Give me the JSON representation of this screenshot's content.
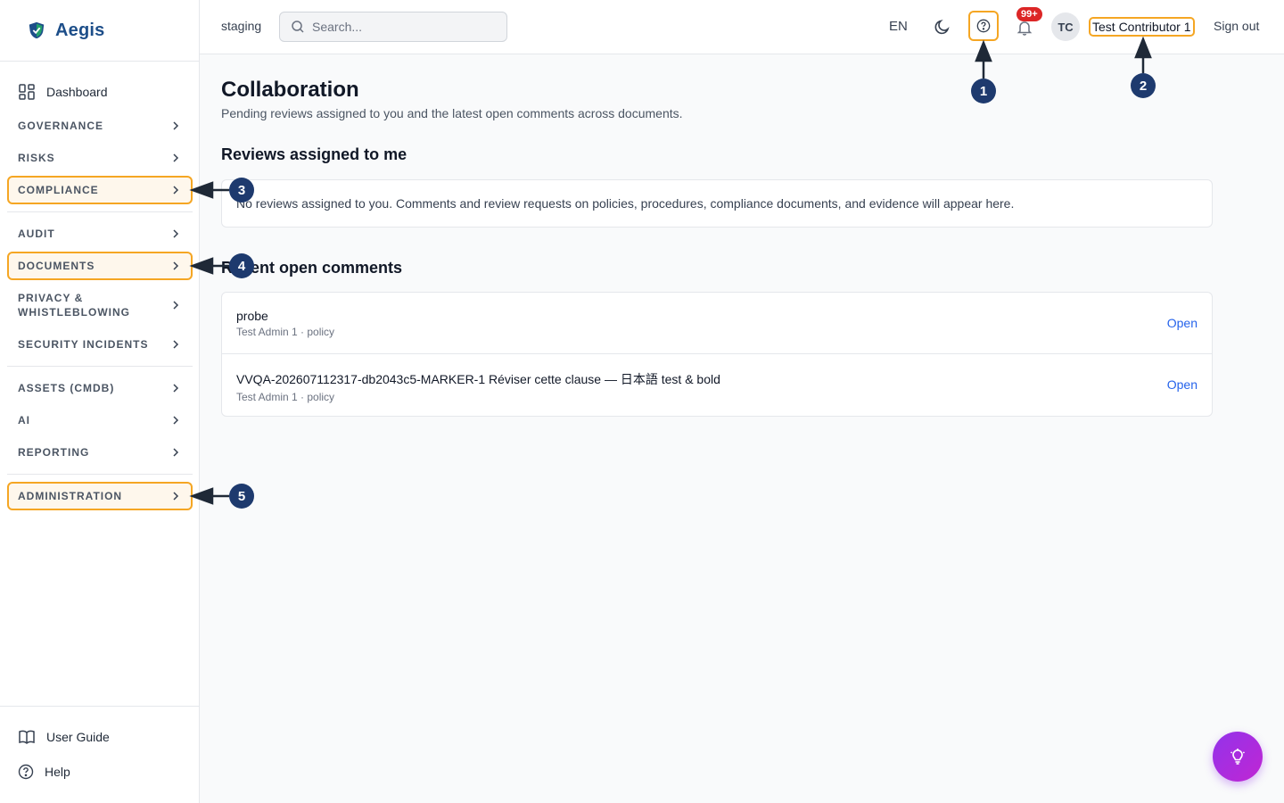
{
  "brand": {
    "name": "Aegis"
  },
  "sidebar": {
    "dashboard": "Dashboard",
    "items": [
      {
        "label": "GOVERNANCE"
      },
      {
        "label": "RISKS"
      },
      {
        "label": "COMPLIANCE"
      },
      {
        "label": "AUDIT"
      },
      {
        "label": "DOCUMENTS"
      },
      {
        "label": "PRIVACY & WHISTLEBLOWING"
      },
      {
        "label": "SECURITY INCIDENTS"
      },
      {
        "label": "ASSETS (CMDB)"
      },
      {
        "label": "AI"
      },
      {
        "label": "REPORTING"
      },
      {
        "label": "ADMINISTRATION"
      }
    ],
    "bottom": {
      "user_guide": "User Guide",
      "help": "Help"
    }
  },
  "topbar": {
    "environment": "staging",
    "search_placeholder": "Search...",
    "language": "EN",
    "notification_count": "99+",
    "avatar_initials": "TC",
    "user_name": "Test Contributor 1",
    "sign_out": "Sign out"
  },
  "page": {
    "title": "Collaboration",
    "subtitle": "Pending reviews assigned to you and the latest open comments across documents.",
    "reviews": {
      "title": "Reviews assigned to me",
      "empty_message": "No reviews assigned to you. Comments and review requests on policies, procedures, compliance documents, and evidence will appear here."
    },
    "comments": {
      "title": "Recent open comments",
      "rows": [
        {
          "title": "probe",
          "meta": "Test Admin 1 · policy",
          "action": "Open"
        },
        {
          "title": "VVQA-202607112317-db2043c5-MARKER-1 Réviser cette clause — 日本語 test & bold",
          "meta": "Test Admin 1 · policy",
          "action": "Open"
        }
      ]
    }
  },
  "callouts": [
    "1",
    "2",
    "3",
    "4",
    "5"
  ],
  "colors": {
    "highlight": "#f5a623",
    "callout": "#1e3a6e",
    "link": "#2563eb",
    "brand": "#1d4e89"
  }
}
